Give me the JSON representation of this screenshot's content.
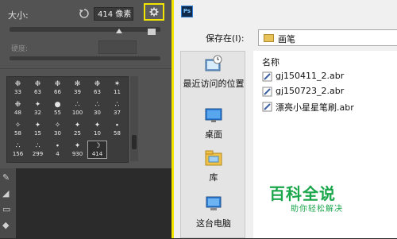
{
  "brush_panel": {
    "size_label": "大小:",
    "size_value": "414 像素",
    "hardness_label": "硬度:",
    "size_slider_fraction": 0.73,
    "brushes": [
      {
        "glyph": "❉",
        "num": "33"
      },
      {
        "glyph": "❉",
        "num": "63"
      },
      {
        "glyph": "❉",
        "num": "66"
      },
      {
        "glyph": "✻",
        "num": "39"
      },
      {
        "glyph": "❉",
        "num": "63"
      },
      {
        "glyph": "✶",
        "num": "11"
      },
      {
        "glyph": "❉",
        "num": "48"
      },
      {
        "glyph": "✦",
        "num": "32"
      },
      {
        "glyph": "●",
        "num": "55"
      },
      {
        "glyph": "∴",
        "num": "100"
      },
      {
        "glyph": "∴",
        "num": "30"
      },
      {
        "glyph": "∴",
        "num": "37"
      },
      {
        "glyph": "✧",
        "num": "58"
      },
      {
        "glyph": "✦",
        "num": "15"
      },
      {
        "glyph": "✧",
        "num": "30"
      },
      {
        "glyph": "✦",
        "num": "25"
      },
      {
        "glyph": "✦",
        "num": "10"
      },
      {
        "glyph": "∙",
        "num": "58"
      },
      {
        "glyph": "∴",
        "num": "156"
      },
      {
        "glyph": "∴",
        "num": "299"
      },
      {
        "glyph": "∙",
        "num": "4"
      },
      {
        "glyph": "✦",
        "num": "930"
      },
      {
        "glyph": "☽",
        "num": "414"
      },
      {
        "glyph": "",
        "num": ""
      }
    ]
  },
  "dialog": {
    "app_logo": "Ps",
    "save_in_label": "保存在(I):",
    "current_folder": "画笔",
    "places": [
      {
        "label": "最近访问的位置",
        "icon": "recent-places-icon"
      },
      {
        "label": "桌面",
        "icon": "desktop-icon"
      },
      {
        "label": "库",
        "icon": "libraries-icon"
      },
      {
        "label": "这台电脑",
        "icon": "computer-icon"
      }
    ],
    "column_name": "名称",
    "files": [
      "gj150411_2.abr",
      "gj150723_2.abr",
      "漂亮小星星笔刷.abr"
    ]
  },
  "watermark": {
    "title": "百科全说",
    "subtitle": "助你轻松解决"
  },
  "colors": {
    "highlight": "#f2e600",
    "watermark": "#1aa64a"
  }
}
